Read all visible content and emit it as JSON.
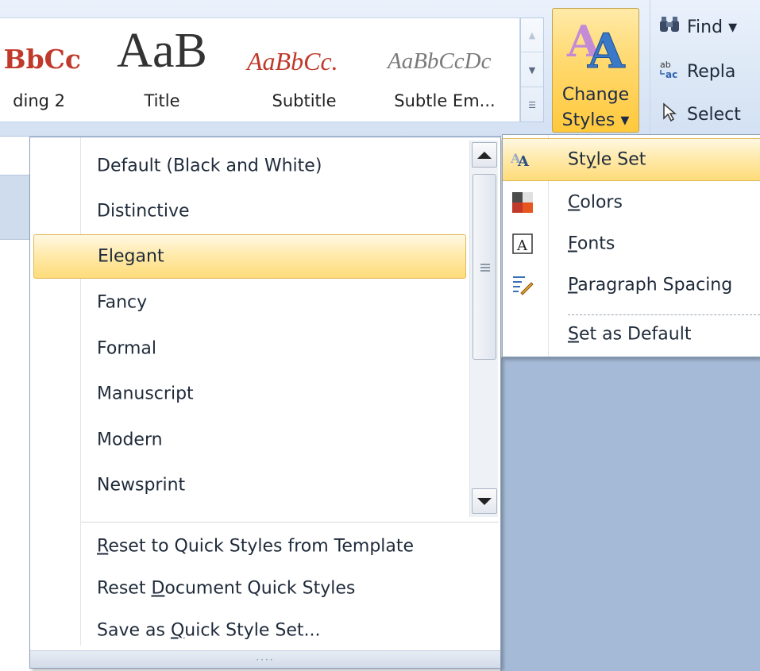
{
  "ribbon": {
    "styles_gallery": [
      {
        "sample": "BbCc",
        "caption": "ding 2"
      },
      {
        "sample": "AaB",
        "caption": "Title"
      },
      {
        "sample": "AaBbCc.",
        "caption": "Subtitle"
      },
      {
        "sample": "AaBbCcDc",
        "caption": "Subtle Em..."
      }
    ],
    "change_styles": {
      "line1": "Change",
      "line2": "Styles ▾"
    },
    "editing": {
      "find": "Find ▾",
      "replace": "Repla",
      "select": "Select"
    }
  },
  "style_set_menu": {
    "items": [
      {
        "label": "Default (Black and White)",
        "highlighted": false
      },
      {
        "label": "Distinctive",
        "highlighted": false
      },
      {
        "label": "Elegant",
        "highlighted": true
      },
      {
        "label": "Fancy",
        "highlighted": false
      },
      {
        "label": "Formal",
        "highlighted": false
      },
      {
        "label": "Manuscript",
        "highlighted": false
      },
      {
        "label": "Modern",
        "highlighted": false
      },
      {
        "label": "Newsprint",
        "highlighted": false
      }
    ],
    "actions": [
      {
        "pre": "",
        "key": "R",
        "post": "eset to Quick Styles from Template"
      },
      {
        "pre": "Reset ",
        "key": "D",
        "post": "ocument Quick Styles"
      },
      {
        "pre": "Save as ",
        "key": "Q",
        "post": "uick Style Set..."
      }
    ],
    "resize_grip": "····"
  },
  "change_styles_submenu": {
    "items": [
      {
        "pre": "St",
        "key": "y",
        "post": "le Set",
        "icon": "style-set-icon",
        "highlighted": true
      },
      {
        "pre": "",
        "key": "C",
        "post": "olors",
        "icon": "colors-icon",
        "highlighted": false
      },
      {
        "pre": "",
        "key": "F",
        "post": "onts",
        "icon": "fonts-icon",
        "highlighted": false
      },
      {
        "pre": "",
        "key": "P",
        "post": "aragraph Spacing",
        "icon": "paragraph-spacing-icon",
        "highlighted": false
      },
      {
        "pre": "",
        "key": "S",
        "post": "et as Default",
        "icon": "",
        "highlighted": false
      }
    ]
  },
  "colors": {
    "highlight": "#ffe9a8",
    "highlight_border": "#e2b95a",
    "heading_red": "#c0392b",
    "ribbon_blue": "#dde8f6"
  }
}
